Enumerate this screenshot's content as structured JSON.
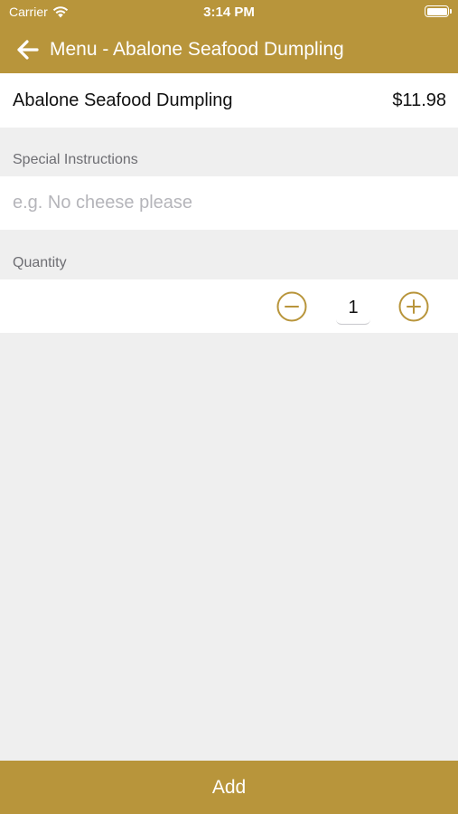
{
  "status_bar": {
    "carrier": "Carrier",
    "time": "3:14 PM"
  },
  "nav": {
    "title": "Menu - Abalone Seafood Dumpling",
    "back_icon": "arrow-left-icon"
  },
  "item": {
    "name": "Abalone Seafood Dumpling",
    "price": "$11.98"
  },
  "special_instructions": {
    "label": "Special Instructions",
    "placeholder": "e.g. No cheese please",
    "value": ""
  },
  "quantity": {
    "label": "Quantity",
    "value": "1",
    "decrement_icon": "minus-circle-icon",
    "increment_icon": "plus-circle-icon"
  },
  "footer": {
    "add_label": "Add"
  },
  "colors": {
    "brand": "#b8953b",
    "background": "#efefef",
    "surface": "#ffffff",
    "secondary_text": "#6e6e73",
    "placeholder_text": "#b5b5ba"
  }
}
